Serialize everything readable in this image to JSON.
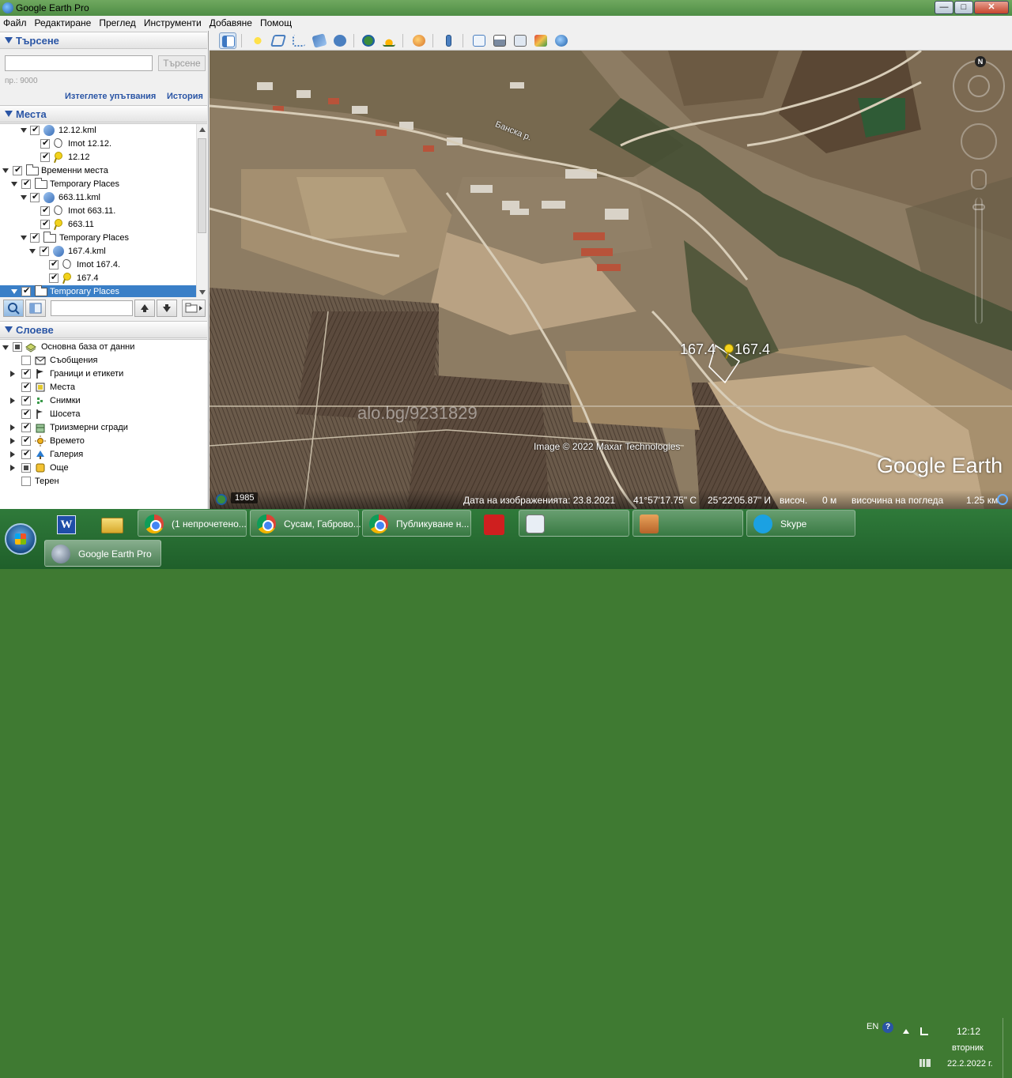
{
  "window": {
    "title": "Google Earth Pro",
    "controls": {
      "minimize": "—",
      "maximize": "□",
      "close": "✕"
    }
  },
  "menu": [
    "Файл",
    "Редактиране",
    "Преглед",
    "Инструменти",
    "Добавяне",
    "Помощ"
  ],
  "search": {
    "header": "Търсене",
    "input_value": "",
    "button": "Търсене",
    "hint": "пр.: 9000",
    "clear_link": "Изтеглете упътвания",
    "history_link": "История"
  },
  "places": {
    "header": "Места",
    "items": [
      {
        "label": "12.12.kml",
        "type": "kml",
        "checked": true
      },
      {
        "label": "Imot 12.12.",
        "type": "polygon",
        "checked": true
      },
      {
        "label": "12.12",
        "type": "pin",
        "checked": true
      },
      {
        "label": "Временни места",
        "type": "folder",
        "checked": true
      },
      {
        "label": "Temporary Places",
        "type": "folder",
        "checked": true
      },
      {
        "label": "663.11.kml",
        "type": "kml",
        "checked": true
      },
      {
        "label": "Imot 663.11.",
        "type": "polygon",
        "checked": true
      },
      {
        "label": "663.11",
        "type": "pin",
        "checked": true
      },
      {
        "label": "Temporary Places",
        "type": "folder",
        "checked": true
      },
      {
        "label": "167.4.kml",
        "type": "kml",
        "checked": true
      },
      {
        "label": "Imot 167.4.",
        "type": "polygon",
        "checked": true
      },
      {
        "label": "167.4",
        "type": "pin",
        "checked": true
      },
      {
        "label": "Temporary Places",
        "type": "folder",
        "checked": true,
        "selected": true
      }
    ]
  },
  "layers": {
    "header": "Слоеве",
    "items": [
      {
        "label": "Основна база от данни",
        "icon": "database-icon"
      },
      {
        "label": "Съобщения",
        "icon": "envelope-icon"
      },
      {
        "label": "Граници и етикети",
        "icon": "flag-icon"
      },
      {
        "label": "Места",
        "icon": "places-icon"
      },
      {
        "label": "Снимки",
        "icon": "photos-icon"
      },
      {
        "label": "Шосета",
        "icon": "roads-icon"
      },
      {
        "label": "Триизмерни сгради",
        "icon": "buildings-icon"
      },
      {
        "label": "Времето",
        "icon": "weather-icon"
      },
      {
        "label": "Галерия",
        "icon": "gallery-icon"
      },
      {
        "label": "Още",
        "icon": "more-icon"
      },
      {
        "label": "Терен",
        "icon": ""
      }
    ]
  },
  "map": {
    "placemark_left_label": "167.4",
    "placemark_right_label": "167.4",
    "river_label": "Банска р.",
    "watermark": "alo.bg/9231829",
    "copyright": "Image © 2022 Maxar Technologies",
    "logo": "Google Earth",
    "compass_n": "N"
  },
  "status": {
    "year": "1985",
    "imagery_date": "Дата на изображенията: 23.8.2021",
    "lat": "41°57'17.75\" С",
    "lon": "25°22'05.87\" И",
    "elevation_label": "височ.",
    "elevation_value": "0 м",
    "eye_alt_label": "височина на погледа",
    "eye_alt_value": "1.25 км"
  },
  "taskbar": {
    "items": [
      "(1 непрочетено...",
      "Сусам, Габрово...",
      "Публикуване н...",
      "",
      "",
      "",
      "Skype"
    ],
    "active": "Google Earth Pro",
    "lang": "EN",
    "time": "12:12",
    "weekday": "вторник",
    "date": "22.2.2022 г."
  }
}
